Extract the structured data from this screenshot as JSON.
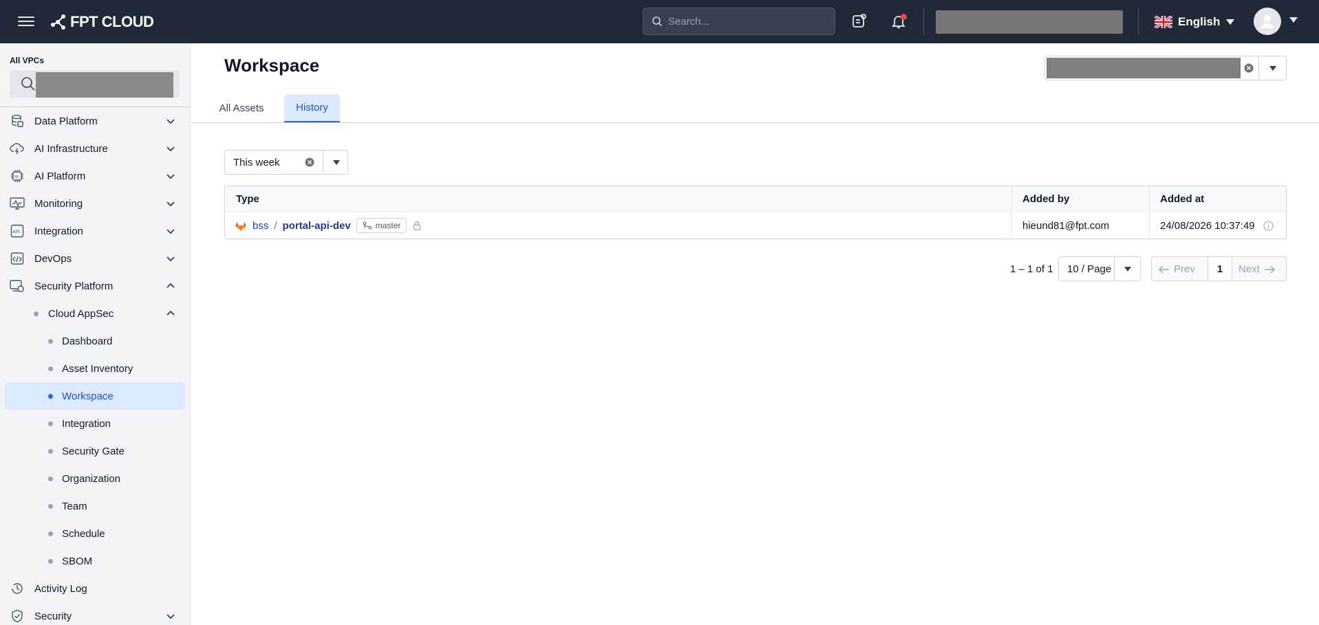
{
  "header": {
    "brand": "FPT CLOUD",
    "search_placeholder": "Search...",
    "language": "English"
  },
  "sidebar": {
    "vpc_label": "All VPCs",
    "items": [
      {
        "label": "Data Platform",
        "icon": "database-icon",
        "expanded": false
      },
      {
        "label": "AI Infrastructure",
        "icon": "cloud-lightning-icon",
        "expanded": false
      },
      {
        "label": "AI Platform",
        "icon": "ai-chip-icon",
        "expanded": false
      },
      {
        "label": "Monitoring",
        "icon": "monitor-chart-icon",
        "expanded": false
      },
      {
        "label": "Integration",
        "icon": "api-icon",
        "expanded": false
      },
      {
        "label": "DevOps",
        "icon": "code-window-icon",
        "expanded": false
      },
      {
        "label": "Security Platform",
        "icon": "security-monitor-icon",
        "expanded": true
      }
    ],
    "sub_item": {
      "label": "Cloud AppSec",
      "expanded": true
    },
    "leaves": [
      "Dashboard",
      "Asset Inventory",
      "Workspace",
      "Integration",
      "Security Gate",
      "Organization",
      "Team",
      "Schedule",
      "SBOM"
    ],
    "active_leaf": "Workspace",
    "bottom_items": [
      {
        "label": "Activity Log",
        "icon": "clock-history-icon"
      },
      {
        "label": "Security",
        "icon": "shield-check-icon"
      }
    ]
  },
  "main": {
    "title": "Workspace",
    "tabs": [
      {
        "label": "All Assets",
        "active": false
      },
      {
        "label": "History",
        "active": true
      }
    ],
    "date_filter": "This week",
    "table": {
      "columns": [
        "Type",
        "Added by",
        "Added at"
      ],
      "rows": [
        {
          "namespace": "bss",
          "separator": "/",
          "repo": "portal-api-dev",
          "branch": "master",
          "added_by": "hieund81@fpt.com",
          "added_at": "24/08/2026 10:37:49"
        }
      ]
    },
    "pagination": {
      "range": "1 – 1 of 1",
      "per_page": "10 / Page",
      "prev": "Prev",
      "current": "1",
      "next": "Next"
    }
  },
  "colors": {
    "header_bg": "#1f2937",
    "accent": "#2563eb",
    "active_bg": "#dbeafe",
    "notification": "#ef4444"
  }
}
